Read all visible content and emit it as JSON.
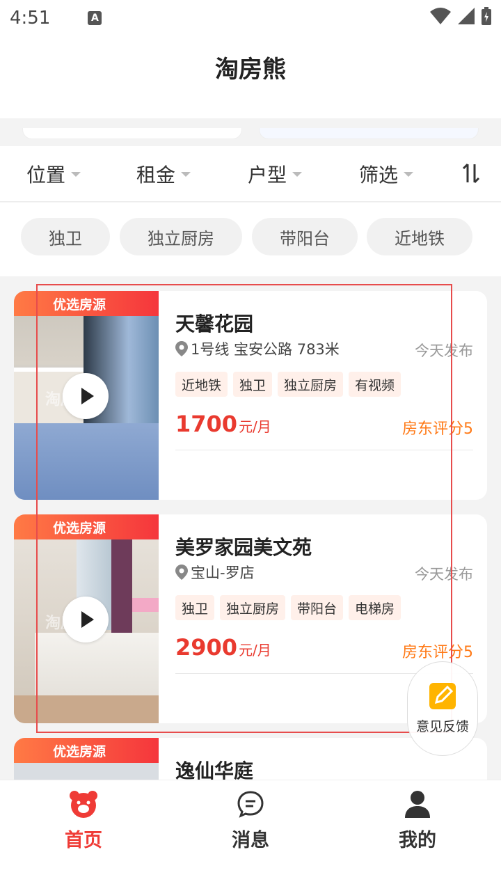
{
  "status": {
    "time": "4:51",
    "a_icon": "A"
  },
  "header": {
    "title": "淘房熊"
  },
  "filters": [
    {
      "label": "位置"
    },
    {
      "label": "租金"
    },
    {
      "label": "户型"
    },
    {
      "label": "筛选"
    }
  ],
  "chips": [
    "独卫",
    "独立厨房",
    "带阳台",
    "近地铁"
  ],
  "listings": [
    {
      "badge": "优选房源",
      "name": "天馨花园",
      "location": "1号线 宝安公路 783米",
      "date": "今天发布",
      "tags": [
        "近地铁",
        "独卫",
        "独立厨房",
        "有视频"
      ],
      "price": "1700",
      "unit": "元/月",
      "rating": "房东评分5",
      "watermark": "淘房熊"
    },
    {
      "badge": "优选房源",
      "name": "美罗家园美文苑",
      "location": "宝山-罗店",
      "date": "今天发布",
      "tags": [
        "独卫",
        "独立厨房",
        "带阳台",
        "电梯房"
      ],
      "price": "2900",
      "unit": "元/月",
      "rating": "房东评分5",
      "watermark": "淘房熊"
    },
    {
      "badge": "优选房源",
      "name": "逸仙华庭"
    }
  ],
  "feedback": {
    "label": "意见反馈"
  },
  "tabs": [
    {
      "label": "首页",
      "icon": "bear-home-icon",
      "active": true
    },
    {
      "label": "消息",
      "icon": "message-icon",
      "active": false
    },
    {
      "label": "我的",
      "icon": "person-icon",
      "active": false
    }
  ],
  "colors": {
    "accent": "#ef3b36",
    "price": "#e93a2f",
    "rating": "#ff7a17",
    "badge_start": "#ff7a45",
    "badge_end": "#f5363c"
  }
}
